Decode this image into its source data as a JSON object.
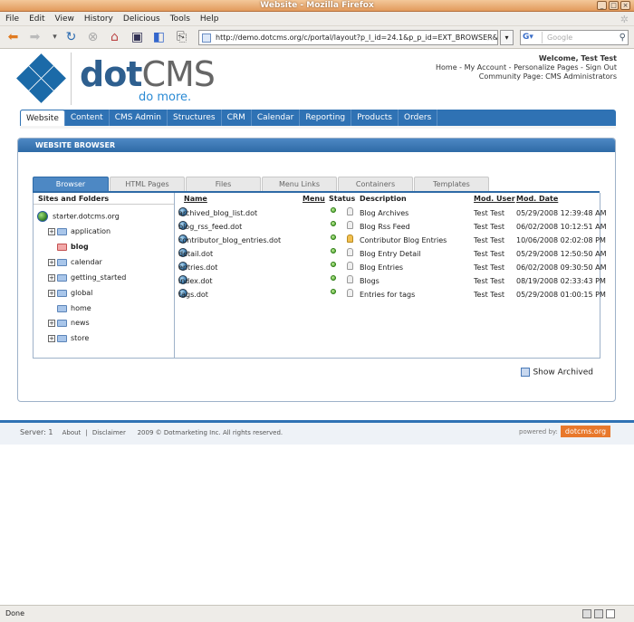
{
  "window": {
    "title": "Website - Mozilla Firefox"
  },
  "menu": [
    "File",
    "Edit",
    "View",
    "History",
    "Delicious",
    "Tools",
    "Help"
  ],
  "url": "http://demo.dotcms.org/c/portal/layout?p_l_id=24.1&p_p_id=EXT_BROWSER&",
  "search": {
    "engine": "G",
    "placeholder": "Google"
  },
  "header": {
    "logo_text_1": "dot",
    "logo_text_2": "CMS",
    "tagline": "do more.",
    "welcome": "Welcome, Test Test",
    "links": [
      "Home",
      "My Account",
      "Personalize Pages",
      "Sign Out"
    ],
    "community": "Community Page: CMS Administrators"
  },
  "main_tabs": [
    "Website",
    "Content",
    "CMS Admin",
    "Structures",
    "CRM",
    "Calendar",
    "Reporting",
    "Products",
    "Orders"
  ],
  "panel": {
    "title": "WEBSITE BROWSER",
    "sub_tabs": [
      "Browser",
      "HTML Pages",
      "Files",
      "Menu Links",
      "Containers",
      "Templates"
    ],
    "tree_header": "Sites and Folders",
    "site": "starter.dotcms.org",
    "folders": [
      "application",
      "blog",
      "calendar",
      "getting_started",
      "global",
      "home",
      "news",
      "store"
    ],
    "columns": {
      "name": "Name",
      "menu": "Menu",
      "status": "Status",
      "description": "Description",
      "mod_user": "Mod. User",
      "mod_date": "Mod. Date"
    },
    "files": [
      {
        "name": "archived_blog_list.dot",
        "description": "Blog Archives",
        "user": "Test Test",
        "date": "05/29/2008 12:39:48 AM"
      },
      {
        "name": "blog_rss_feed.dot",
        "description": "Blog Rss Feed",
        "user": "Test Test",
        "date": "06/02/2008 10:12:51 AM"
      },
      {
        "name": "contributor_blog_entries.dot",
        "description": "Contributor Blog Entries",
        "user": "Test Test",
        "date": "10/06/2008 02:02:08 PM"
      },
      {
        "name": "detail.dot",
        "description": "Blog Entry Detail",
        "user": "Test Test",
        "date": "05/29/2008 12:50:50 AM"
      },
      {
        "name": "entries.dot",
        "description": "Blog Entries",
        "user": "Test Test",
        "date": "06/02/2008 09:30:50 AM"
      },
      {
        "name": "index.dot",
        "description": "Blogs",
        "user": "Test Test",
        "date": "08/19/2008 02:33:43 PM"
      },
      {
        "name": "tags.dot",
        "description": "Entries for tags",
        "user": "Test Test",
        "date": "05/29/2008 01:00:15 PM"
      }
    ],
    "show_archived": "Show Archived"
  },
  "footer": {
    "server": "Server: 1",
    "about": "About",
    "sep": "|",
    "disclaimer": "Disclaimer",
    "copyright": "2009 © Dotmarketing Inc. All rights reserved.",
    "powered_by": "powered by:",
    "brand": "dotcms.org"
  },
  "status": {
    "text": "Done"
  }
}
